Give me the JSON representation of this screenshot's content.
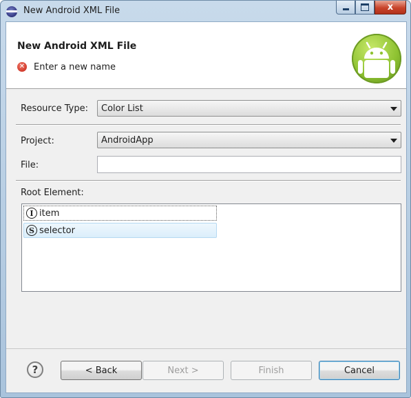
{
  "window": {
    "title": "New Android XML File",
    "controls": {
      "minimize": "minimize",
      "maximize": "maximize",
      "close": "x"
    }
  },
  "header": {
    "title": "New Android XML File",
    "error_message": "Enter a new name",
    "error_icon": "error-icon",
    "logo_icon": "android-logo"
  },
  "form": {
    "resource_type": {
      "label": "Resource Type:",
      "value": "Color List"
    },
    "project": {
      "label": "Project:",
      "value": "AndroidApp"
    },
    "file": {
      "label": "File:",
      "value": ""
    },
    "root_element": {
      "label": "Root Element:",
      "items": [
        {
          "glyph": "I",
          "label": "item"
        },
        {
          "glyph": "S",
          "label": "selector"
        }
      ]
    }
  },
  "buttons": {
    "help": "?",
    "back": "< Back",
    "next": "Next >",
    "finish": "Finish",
    "cancel": "Cancel"
  },
  "colors": {
    "window_frame": "#a9c3dc",
    "close_button": "#c8432a",
    "selection": "#dbeefb",
    "android_green": "#8fc332"
  }
}
